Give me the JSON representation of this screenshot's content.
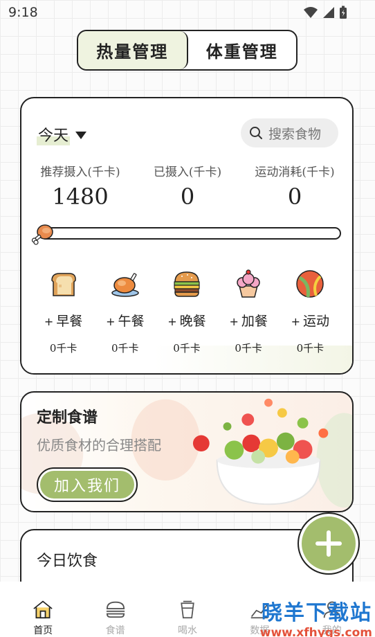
{
  "status": {
    "time": "9:18"
  },
  "segment": {
    "tabs": [
      "热量管理",
      "体重管理"
    ],
    "active": 0
  },
  "summary": {
    "date_label": "今天",
    "search_placeholder": "搜索食物",
    "stats": [
      {
        "label": "推荐摄入(千卡)",
        "value": "1480"
      },
      {
        "label": "已摄入(千卡)",
        "value": "0"
      },
      {
        "label": "运动消耗(千卡)",
        "value": "0"
      }
    ],
    "progress": 0
  },
  "meals": [
    {
      "label": "早餐",
      "kcal": "0千卡",
      "icon": "toast-icon"
    },
    {
      "label": "午餐",
      "kcal": "0千卡",
      "icon": "roast-chicken-icon"
    },
    {
      "label": "晚餐",
      "kcal": "0千卡",
      "icon": "burger-icon"
    },
    {
      "label": "加餐",
      "kcal": "0千卡",
      "icon": "cupcake-icon"
    },
    {
      "label": "运动",
      "kcal": "0千卡",
      "icon": "ball-icon"
    }
  ],
  "meal_plus": "+",
  "recipe": {
    "title": "定制食谱",
    "subtitle": "优质食材的合理搭配",
    "button": "加入我们"
  },
  "today_diet": {
    "title": "今日饮食"
  },
  "tabbar": [
    {
      "label": "首页",
      "icon": "home-icon"
    },
    {
      "label": "食谱",
      "icon": "food-icon"
    },
    {
      "label": "喝水",
      "icon": "cup-icon"
    },
    {
      "label": "数据",
      "icon": "chart-icon"
    },
    {
      "label": "我的",
      "icon": "profile-icon"
    }
  ],
  "watermark": {
    "main": "晓羊下载站",
    "sub": "www.xfhygs.com"
  },
  "colors": {
    "accent": "#a3bd6d",
    "active_tab_bg": "#eff3e0",
    "brand_blue": "#1f77d0"
  }
}
